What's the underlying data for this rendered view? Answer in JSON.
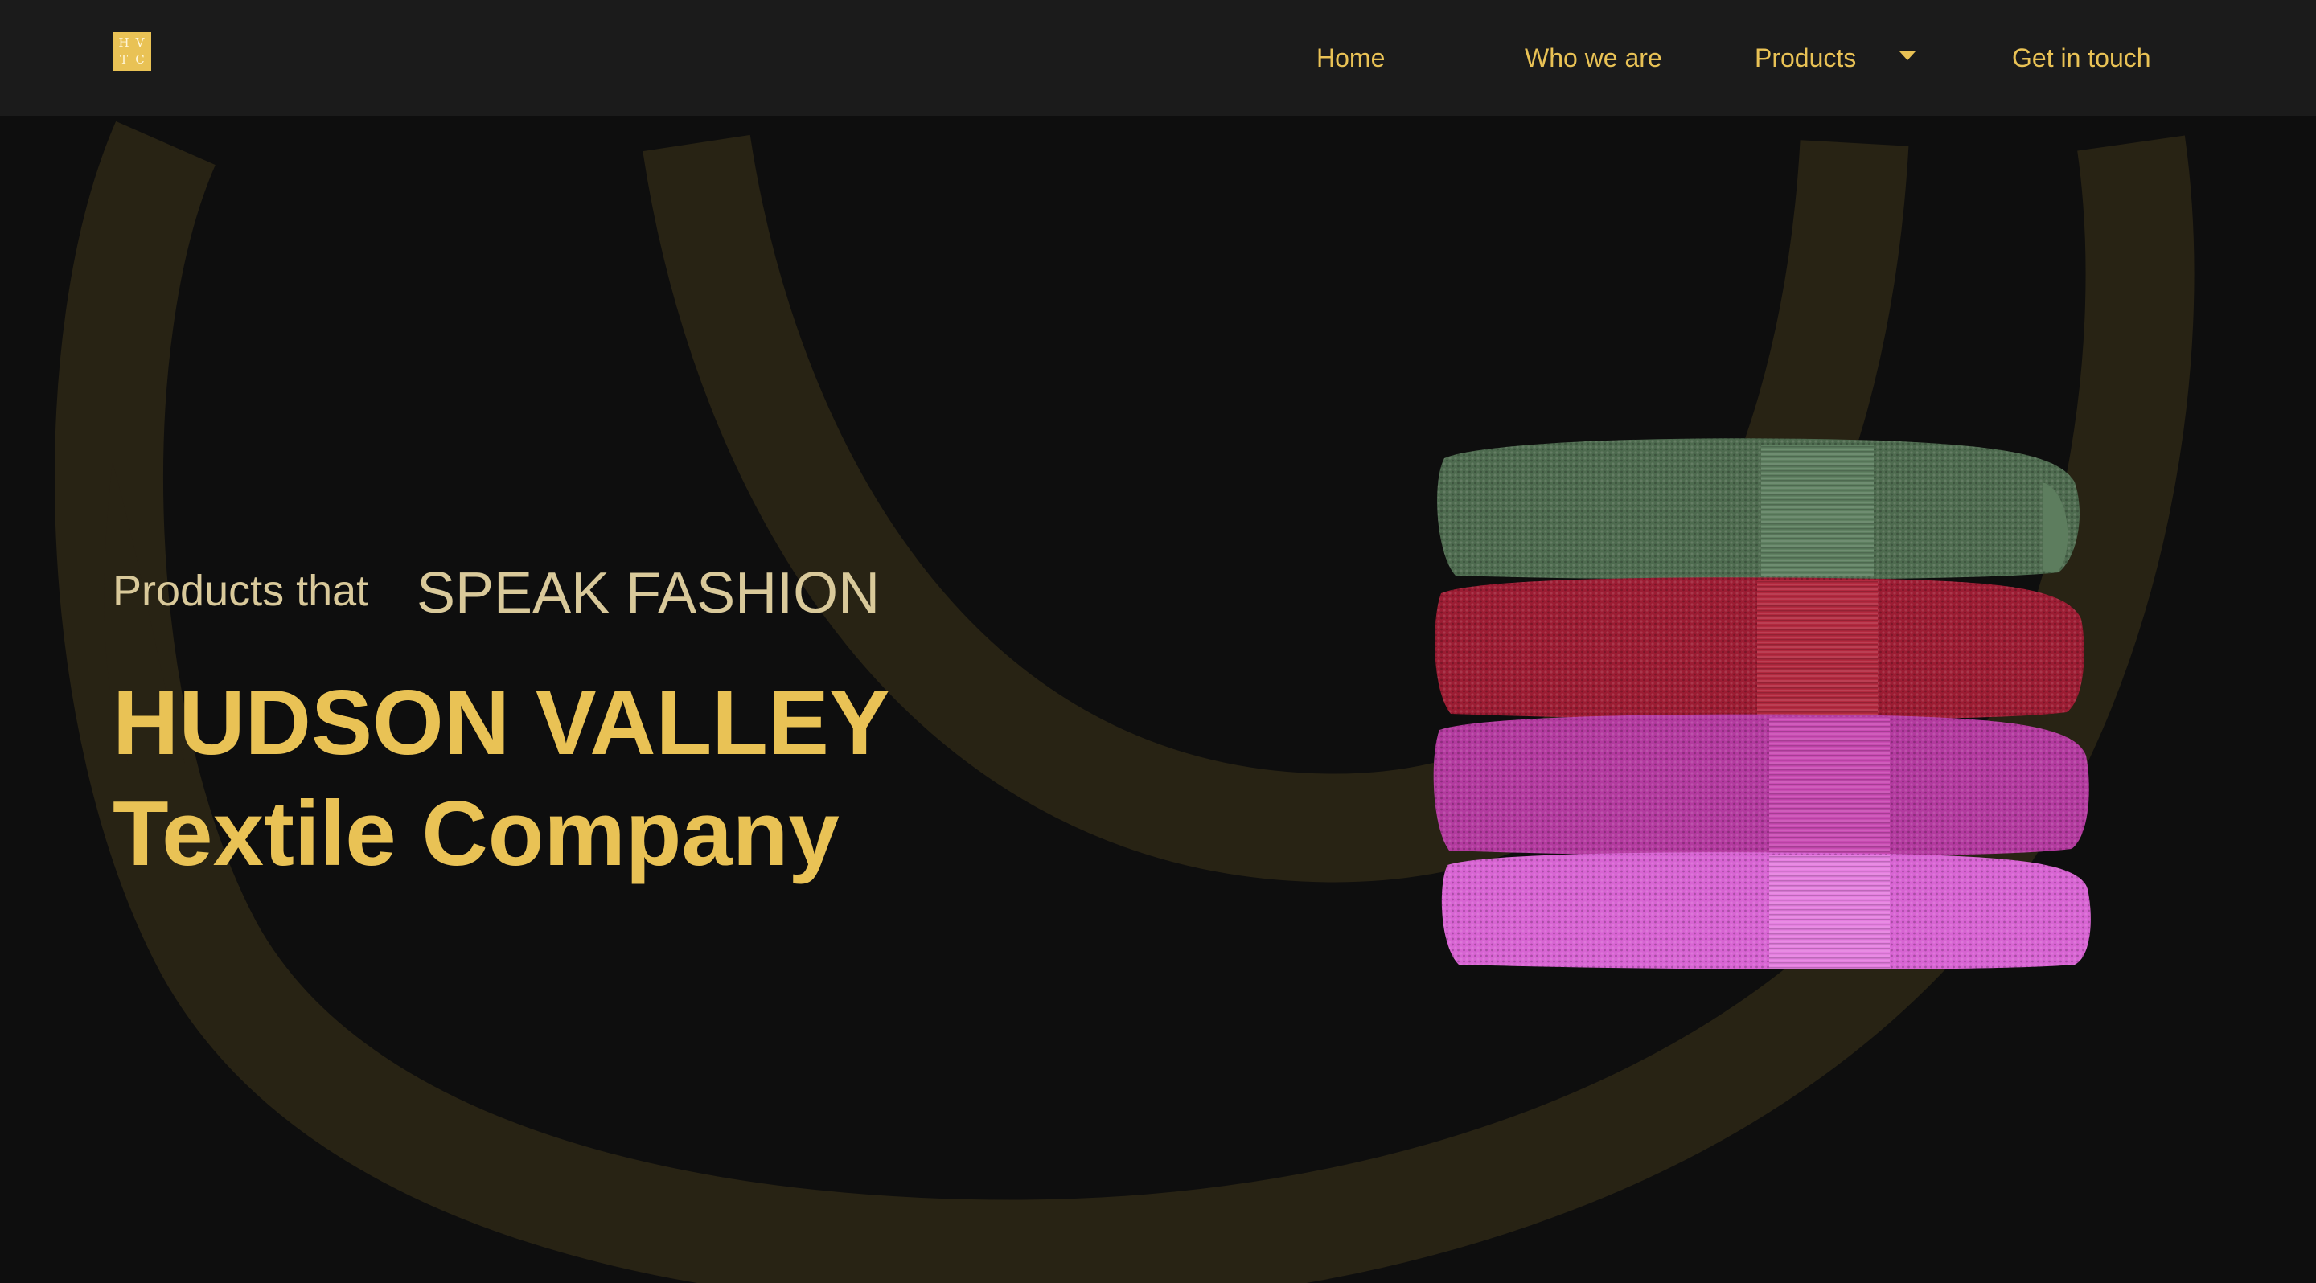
{
  "nav": {
    "logo_letters": [
      "H",
      "V",
      "T",
      "C"
    ],
    "items": [
      {
        "label": "Home"
      },
      {
        "label": "Who we are"
      },
      {
        "label": "Products"
      },
      {
        "label": "Get in touch"
      }
    ]
  },
  "hero": {
    "tagline_lead": "Products that",
    "tagline_emphasis": "SPEAK FASHION",
    "brand_line1": "HUDSON VALLEY",
    "brand_line2": "Textile Company"
  },
  "towels": {
    "colors": [
      "#4e6b4f",
      "#9c1c33",
      "#b33a9f",
      "#d864d3"
    ]
  },
  "colors": {
    "accent": "#e9c255",
    "tagline": "#d9c99a",
    "background": "#0e0e0e",
    "navbar": "#1b1b1b"
  },
  "icons": {
    "logo": "hvtc-monogram-logo",
    "dropdown": "caret-down-icon"
  }
}
